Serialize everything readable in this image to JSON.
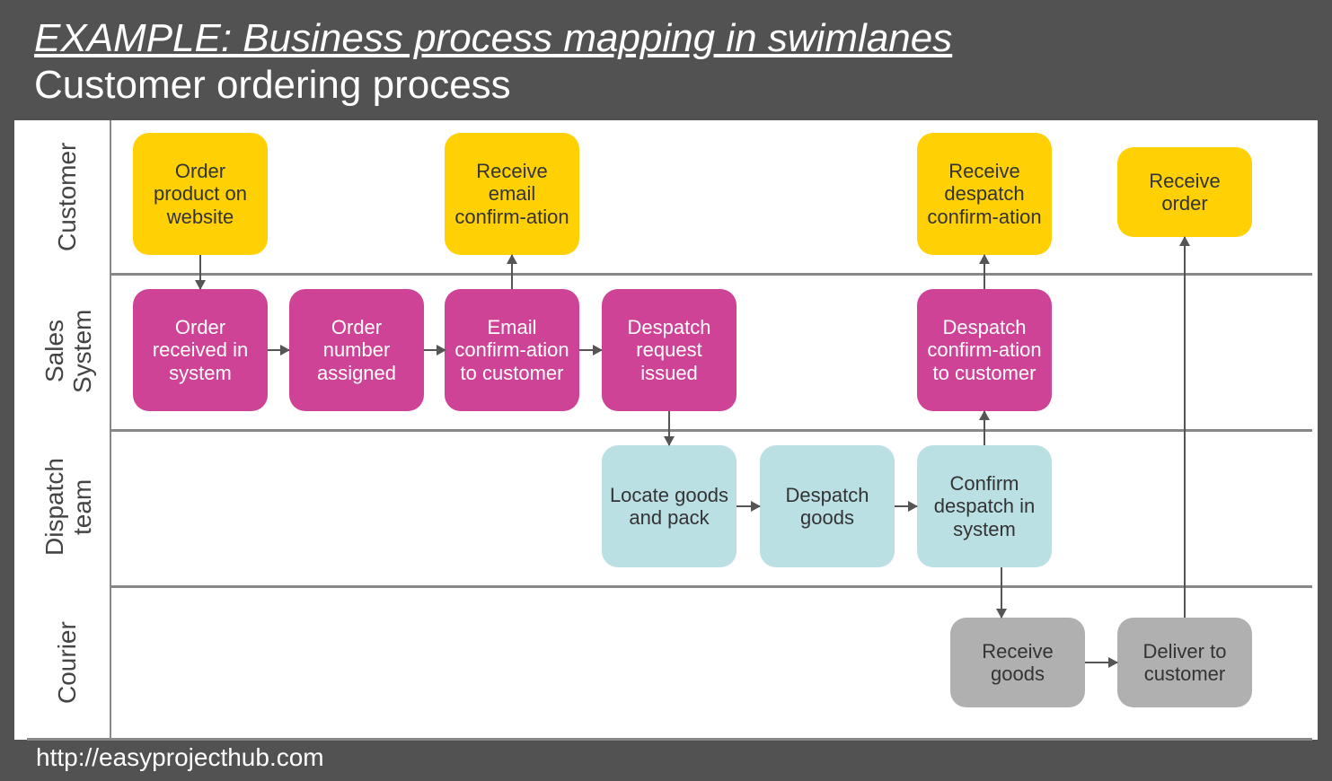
{
  "title": "EXAMPLE: Business process mapping in swimlanes",
  "subtitle": "Customer ordering process",
  "footer": "http://easyprojecthub.com",
  "colors": {
    "customer": "#ffd105",
    "sales_system": "#cf4397",
    "dispatch_team": "#bbe0e3",
    "courier": "#b0b0b0"
  },
  "lanes": [
    {
      "id": "customer",
      "label": "Customer"
    },
    {
      "id": "sales-system",
      "label": "Sales\nSystem"
    },
    {
      "id": "dispatch-team",
      "label": "Dispatch\nteam"
    },
    {
      "id": "courier",
      "label": "Courier"
    }
  ],
  "nodes": {
    "c1": {
      "lane": "customer",
      "label": "Order product on website"
    },
    "c2": {
      "lane": "customer",
      "label": "Receive email confirm-ation"
    },
    "c3": {
      "lane": "customer",
      "label": "Receive despatch confirm-ation"
    },
    "c4": {
      "lane": "customer",
      "label": "Receive order"
    },
    "s1": {
      "lane": "sales-system",
      "label": "Order received in system"
    },
    "s2": {
      "lane": "sales-system",
      "label": "Order number assigned"
    },
    "s3": {
      "lane": "sales-system",
      "label": "Email confirm-ation to customer"
    },
    "s4": {
      "lane": "sales-system",
      "label": "Despatch request issued"
    },
    "s5": {
      "lane": "sales-system",
      "label": "Despatch confirm-ation to customer"
    },
    "d1": {
      "lane": "dispatch-team",
      "label": "Locate goods and pack"
    },
    "d2": {
      "lane": "dispatch-team",
      "label": "Despatch goods"
    },
    "d3": {
      "lane": "dispatch-team",
      "label": "Confirm despatch in system"
    },
    "r1": {
      "lane": "courier",
      "label": "Receive goods"
    },
    "r2": {
      "lane": "courier",
      "label": "Deliver to customer"
    }
  },
  "edges": [
    [
      "c1",
      "s1"
    ],
    [
      "s1",
      "s2"
    ],
    [
      "s2",
      "s3"
    ],
    [
      "s3",
      "c2"
    ],
    [
      "s3",
      "s4"
    ],
    [
      "s4",
      "d1"
    ],
    [
      "d1",
      "d2"
    ],
    [
      "d2",
      "d3"
    ],
    [
      "d3",
      "s5"
    ],
    [
      "s5",
      "c3"
    ],
    [
      "d3",
      "r1"
    ],
    [
      "r1",
      "r2"
    ],
    [
      "r2",
      "c4"
    ]
  ]
}
